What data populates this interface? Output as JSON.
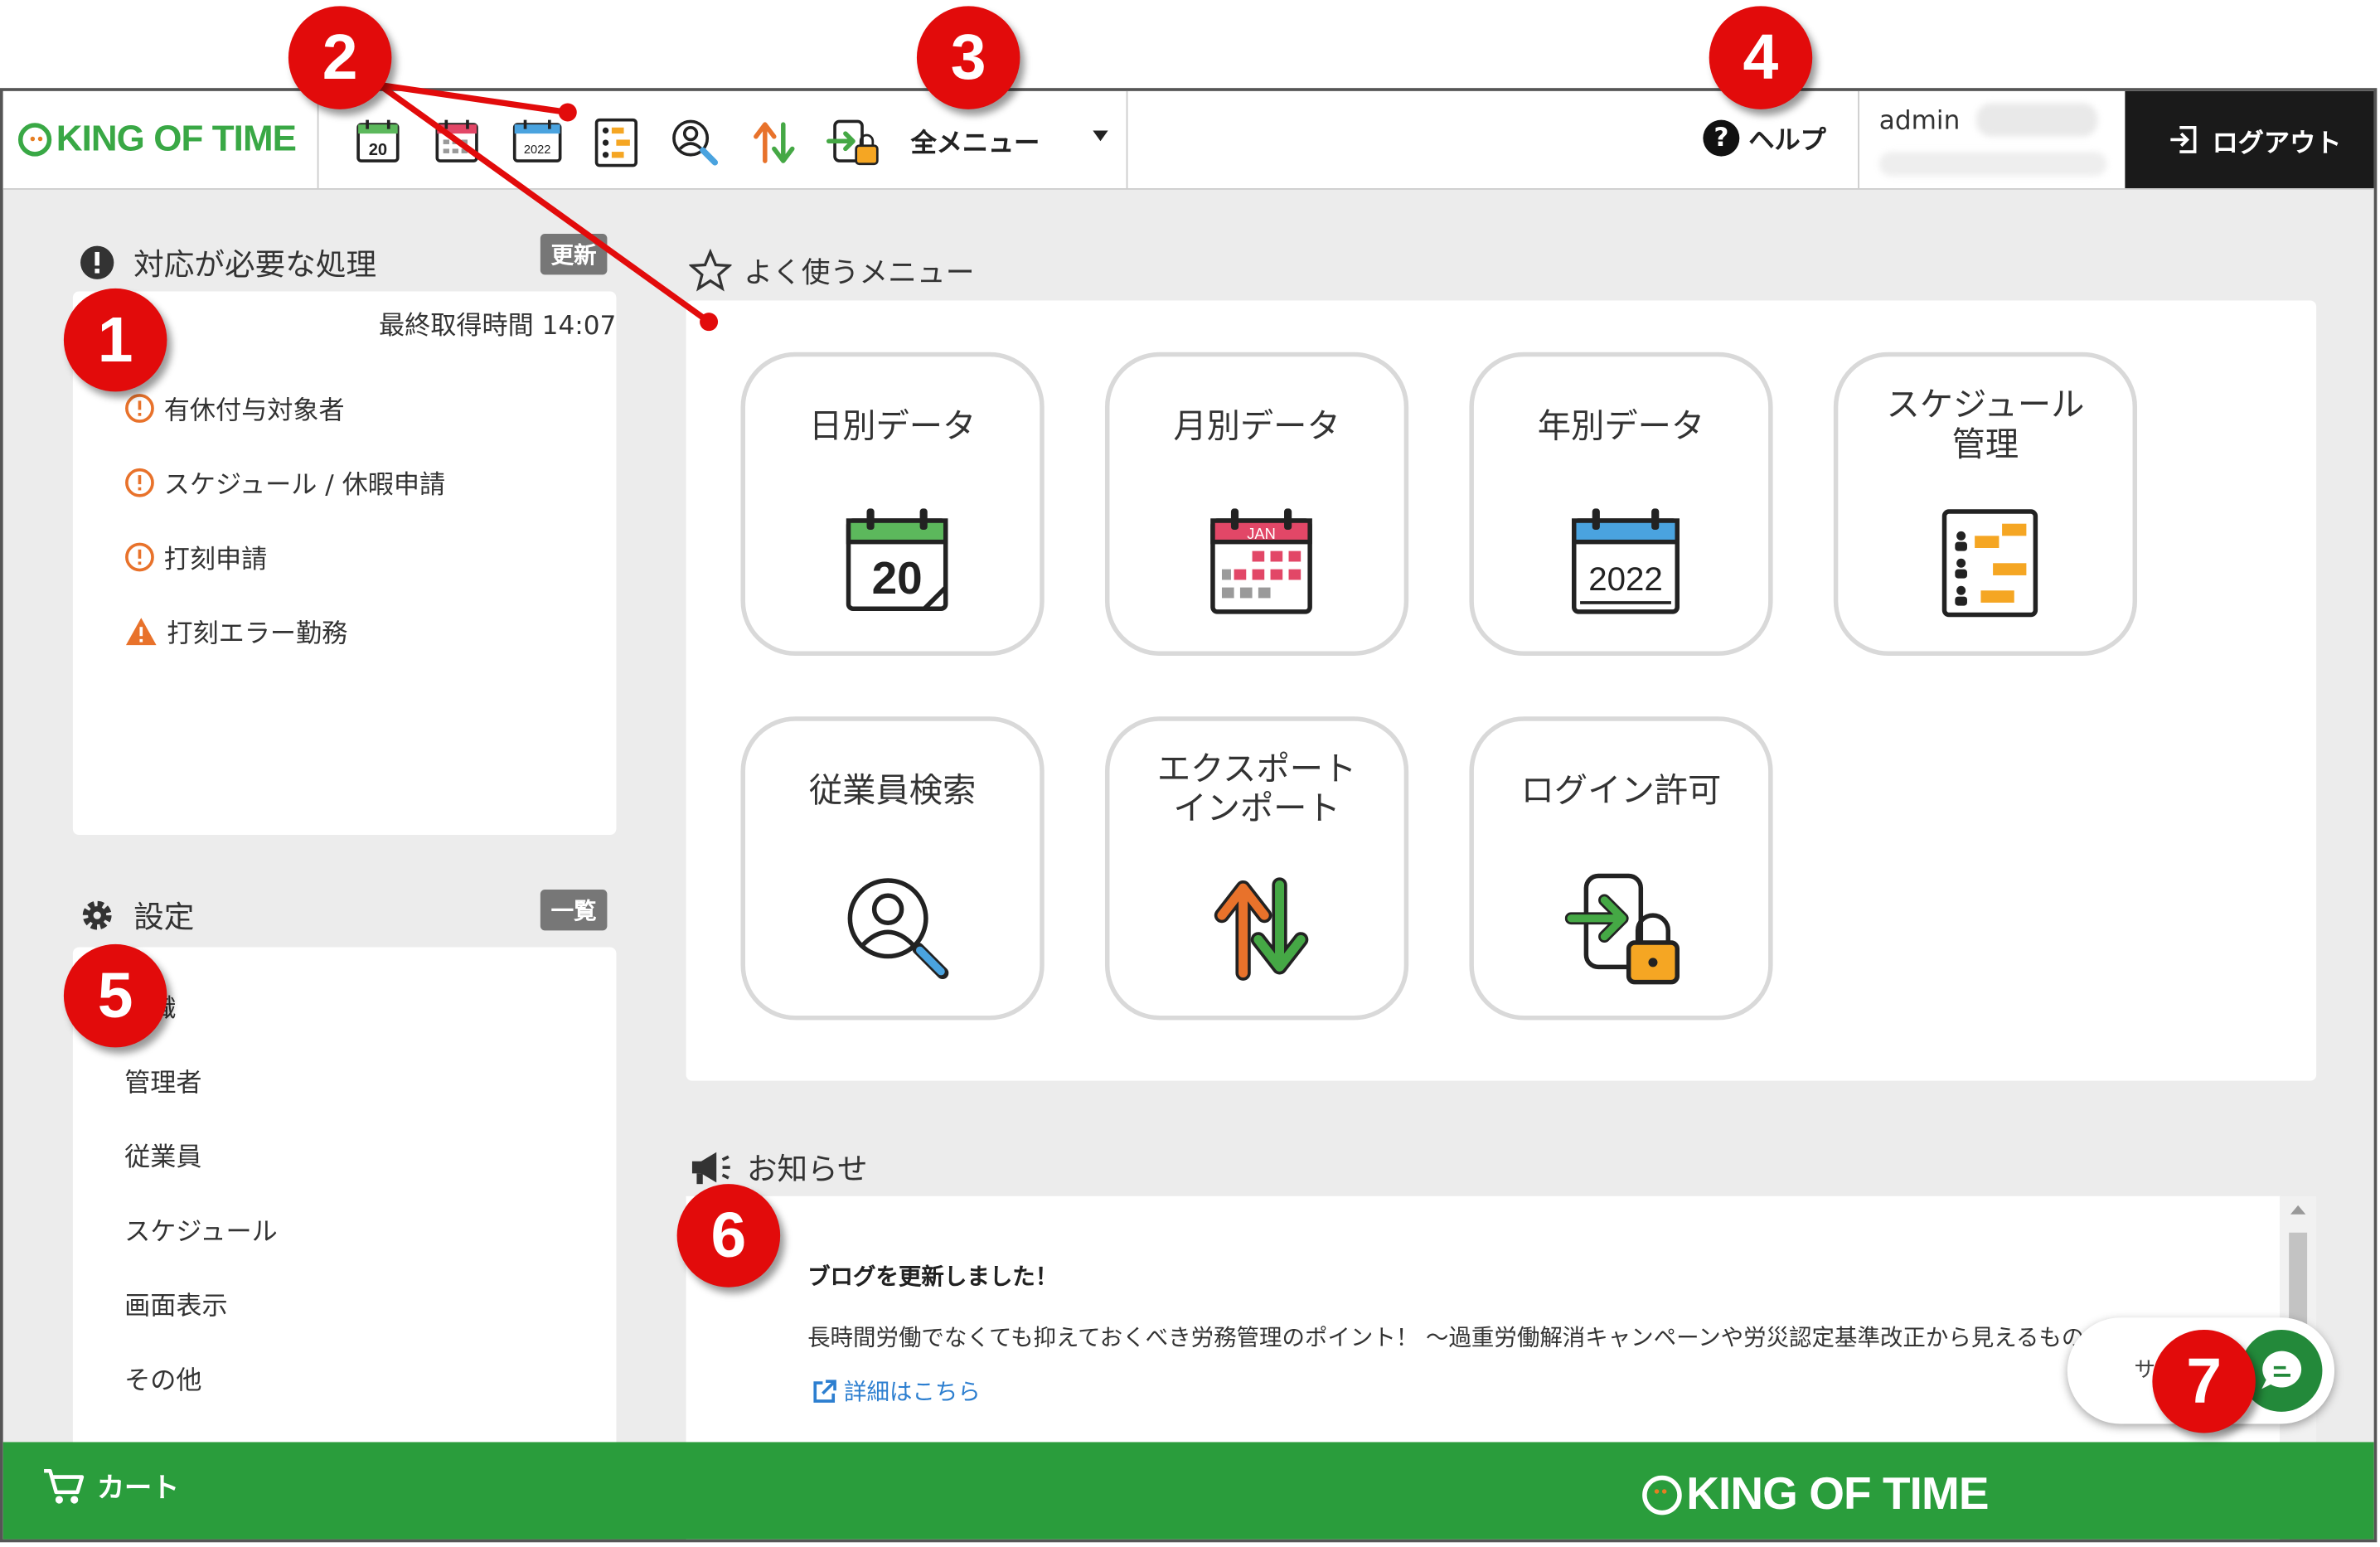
{
  "header": {
    "logo": "KING OF TIME",
    "all_menu": "全メニュー",
    "help": "ヘルプ",
    "user": "admin",
    "logout": "ログアウト",
    "quick_icons": [
      "daily-data-icon",
      "monthly-data-icon",
      "yearly-data-icon",
      "schedule-icon",
      "employee-search-icon",
      "export-import-icon",
      "login-permission-icon"
    ]
  },
  "alerts": {
    "title": "対応が必要な処理",
    "refresh": "更新",
    "last_fetched": "最終取得時間 14:07",
    "items": [
      {
        "label": "有休付与対象者",
        "kind": "info"
      },
      {
        "label": "スケジュール / 休暇申請",
        "kind": "info"
      },
      {
        "label": "打刻申請",
        "kind": "info"
      },
      {
        "label": "打刻エラー勤務",
        "kind": "warning"
      }
    ]
  },
  "settings": {
    "title": "設定",
    "list_button": "一覧",
    "items": [
      "組織",
      "管理者",
      "従業員",
      "スケジュール",
      "画面表示",
      "その他"
    ]
  },
  "favorites": {
    "title": "よく使うメニュー",
    "tiles": [
      {
        "label": "日別データ",
        "icon": "daily-calendar-icon"
      },
      {
        "label": "月別データ",
        "icon": "monthly-calendar-icon"
      },
      {
        "label": "年別データ",
        "icon": "yearly-calendar-icon"
      },
      {
        "label": "スケジュール\n管理",
        "icon": "schedule-management-icon"
      },
      {
        "label": "従業員検索",
        "icon": "employee-search-icon"
      },
      {
        "label": "エクスポート\nインポート",
        "icon": "export-import-icon"
      },
      {
        "label": "ログイン許可",
        "icon": "login-permission-icon"
      }
    ],
    "calendar_texts": {
      "daily": "20",
      "monthly": "JAN",
      "yearly": "2022"
    }
  },
  "news": {
    "title": "お知らせ",
    "headline": "ブログを更新しました！",
    "body": "長時間労働でなくても抑えておくべき労務管理のポイント！ ～過重労働解消キャンペーンや労災認定基準改正から見えるもの～",
    "link": "詳細はこちら"
  },
  "footer": {
    "cart": "カート",
    "logo": "KING OF TIME",
    "support": "サポート"
  },
  "annotations": [
    "1",
    "2",
    "3",
    "4",
    "5",
    "6",
    "7"
  ],
  "colors": {
    "brand_green": "#2a9d3c",
    "annotation_red": "#e20b0b",
    "logout_bg": "#1a1a1a",
    "link_blue": "#2d7fd0"
  }
}
